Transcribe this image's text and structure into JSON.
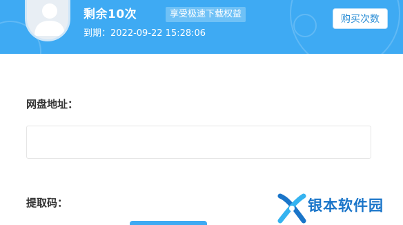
{
  "header": {
    "remaining": "剩余10次",
    "badge": "享受极速下载权益",
    "expire": "到期：2022-09-22 15:28:06",
    "buy_label": "购买次数",
    "avatar_icon": "user-avatar-icon"
  },
  "form": {
    "url_label": "网盘地址：",
    "url_value": "",
    "code_label": "提取码："
  },
  "watermark": {
    "text": "银本软件园",
    "logo_icon": "x-logo-icon"
  },
  "colors": {
    "accent": "#3eaaf3",
    "button_text": "#2e8fd6",
    "watermark": "#1a75c9"
  }
}
